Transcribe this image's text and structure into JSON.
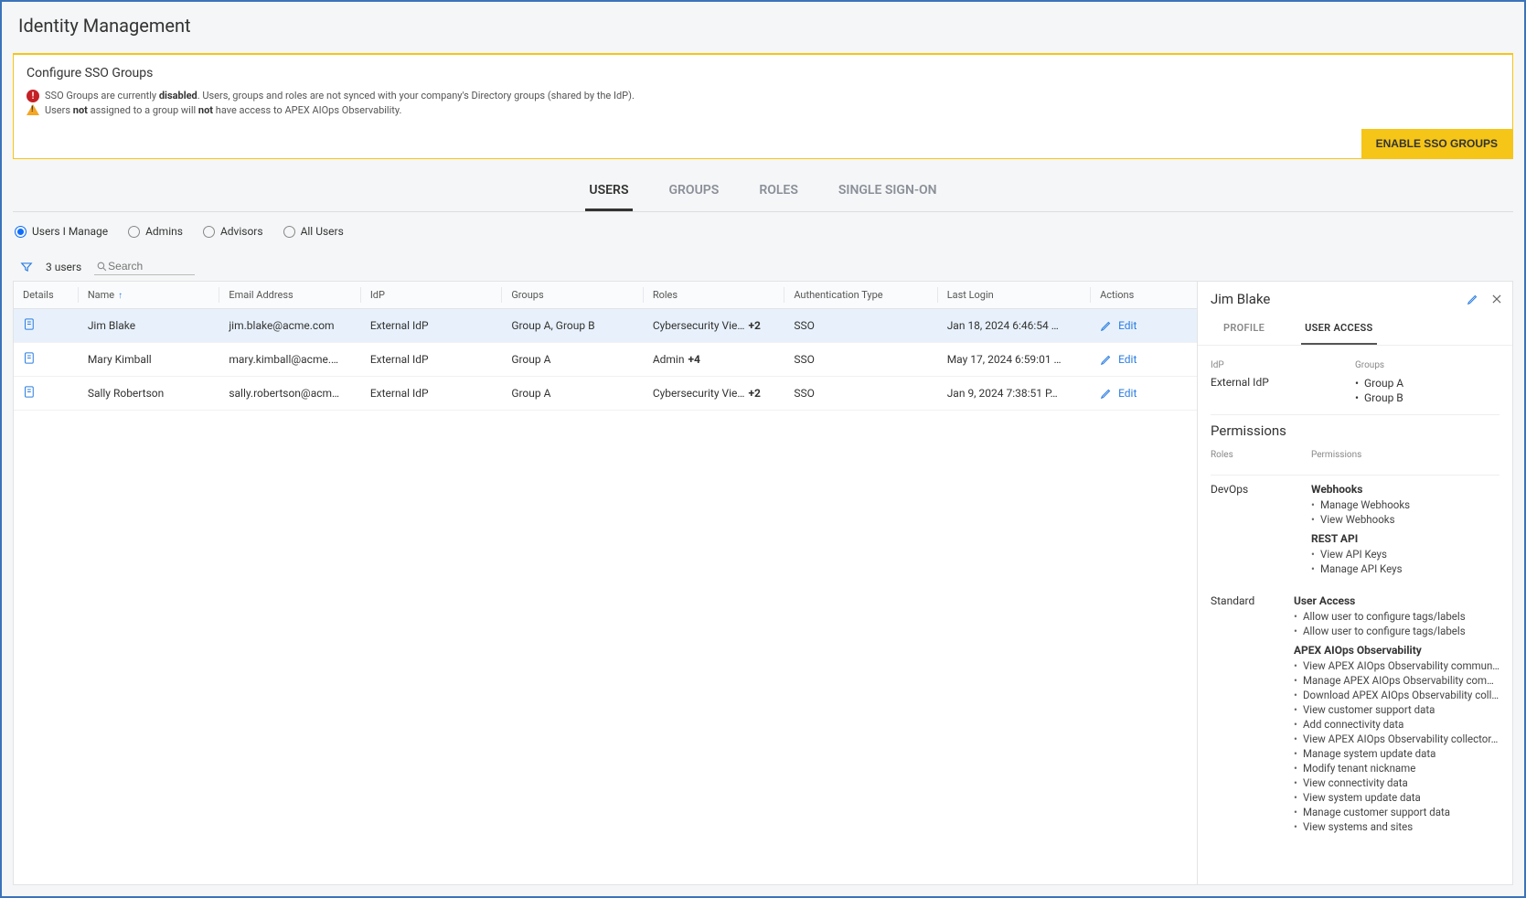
{
  "page_title": "Identity Management",
  "banner": {
    "title": "Configure SSO Groups",
    "line1_pre": "SSO Groups are currently ",
    "line1_bold": "disabled",
    "line1_post": ". Users, groups and roles are not synced with your company's Directory groups (shared by the IdP).",
    "line2_pre": "Users ",
    "line2_bold1": "not",
    "line2_mid": " assigned to a group will ",
    "line2_bold2": "not",
    "line2_post": " have access to APEX AIOps Observability.",
    "button": "ENABLE SSO GROUPS"
  },
  "main_tabs": [
    "USERS",
    "GROUPS",
    "ROLES",
    "SINGLE SIGN-ON"
  ],
  "main_tab_active": 0,
  "radios": [
    "Users I Manage",
    "Admins",
    "Advisors",
    "All Users"
  ],
  "radio_active": 0,
  "toolbar": {
    "count": "3 users",
    "search_placeholder": "Search"
  },
  "table": {
    "headers": [
      "Details",
      "Name",
      "Email Address",
      "IdP",
      "Groups",
      "Roles",
      "Authentication Type",
      "Last Login",
      "Actions"
    ],
    "sort_col": 1,
    "rows": [
      {
        "name": "Jim Blake",
        "email": "jim.blake@acme.com",
        "idp": "External IdP",
        "groups": "Group A, Group B",
        "roles": "Cybersecurity Vie…",
        "roles_more": "+2",
        "auth": "SSO",
        "last_login": "Jan 18, 2024 6:46:54 …",
        "selected": true
      },
      {
        "name": "Mary Kimball",
        "email": "mary.kimball@acme.…",
        "idp": "External IdP",
        "groups": "Group A",
        "roles": "Admin",
        "roles_more": "+4",
        "auth": "SSO",
        "last_login": "May 17, 2024 6:59:01 …",
        "selected": false
      },
      {
        "name": "Sally Robertson",
        "email": "sally.robertson@acm…",
        "idp": "External IdP",
        "groups": "Group A",
        "roles": "Cybersecurity Vie…",
        "roles_more": "+2",
        "auth": "SSO",
        "last_login": "Jan 9, 2024 7:38:51 P…",
        "selected": false
      }
    ],
    "action_label": "Edit"
  },
  "side": {
    "title": "Jim Blake",
    "tabs": [
      "PROFILE",
      "USER ACCESS"
    ],
    "tab_active": 1,
    "idp_label": "IdP",
    "idp_value": "External IdP",
    "groups_label": "Groups",
    "groups": [
      "Group A",
      "Group B"
    ],
    "permissions_title": "Permissions",
    "roles_label": "Roles",
    "permissions_label": "Permissions",
    "roles": [
      {
        "name": "DevOps",
        "perm_groups": [
          {
            "title": "Webhooks",
            "items": [
              "Manage Webhooks",
              "View Webhooks"
            ]
          },
          {
            "title": "REST API",
            "items": [
              "View API Keys",
              "Manage API Keys"
            ]
          }
        ]
      },
      {
        "name": "Standard",
        "perm_groups": [
          {
            "title": "User Access",
            "items": [
              "Allow user to configure tags/labels",
              "Allow user to configure tags/labels"
            ]
          },
          {
            "title": "APEX AIOps Observability",
            "items": [
              "View APEX AIOps Observability commun…",
              "Manage APEX AIOps Observability com…",
              "Download APEX AIOps Observability coll…",
              "View customer support data",
              "Add connectivity data",
              "View APEX AIOps Observability collector…",
              "Manage system update data",
              "Modify tenant nickname",
              "View connectivity data",
              "View system update data",
              "Manage customer support data",
              "View systems and sites"
            ]
          }
        ]
      }
    ]
  }
}
